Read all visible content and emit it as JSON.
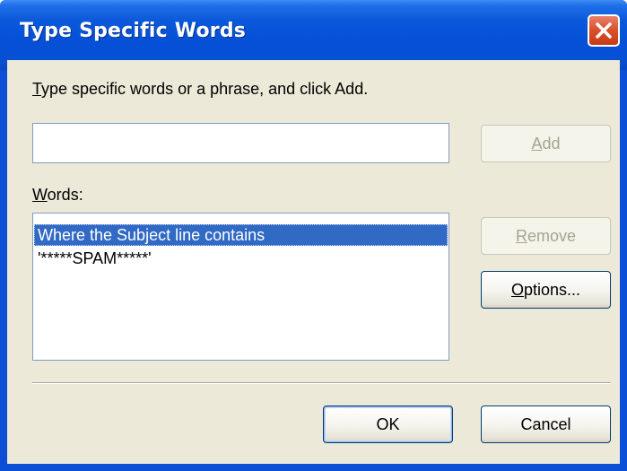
{
  "window": {
    "title": "Type Specific Words"
  },
  "instruction": {
    "mnemonic": "T",
    "text": "ype specific words or a phrase, and click Add."
  },
  "word_input": {
    "value": "",
    "placeholder": ""
  },
  "buttons": {
    "add": {
      "mnemonic": "A",
      "rest": "dd",
      "enabled": false
    },
    "remove": {
      "mnemonic": "R",
      "rest": "emove",
      "enabled": false
    },
    "options": {
      "mnemonic": "O",
      "rest": "ptions...",
      "enabled": true
    },
    "ok": {
      "label": "OK"
    },
    "cancel": {
      "label": "Cancel"
    }
  },
  "words": {
    "mnemonic": "W",
    "rest": "ords:",
    "items": [
      {
        "text": "Where the Subject line contains",
        "selected": true
      },
      {
        "text": "'*****SPAM*****'",
        "selected": false
      }
    ]
  },
  "colors": {
    "titlebar": "#0550d6",
    "close_button": "#d9532e",
    "dialog_face": "#ece9d8",
    "selection": "#316ac5"
  },
  "icons": {
    "close": "close-x-icon"
  }
}
